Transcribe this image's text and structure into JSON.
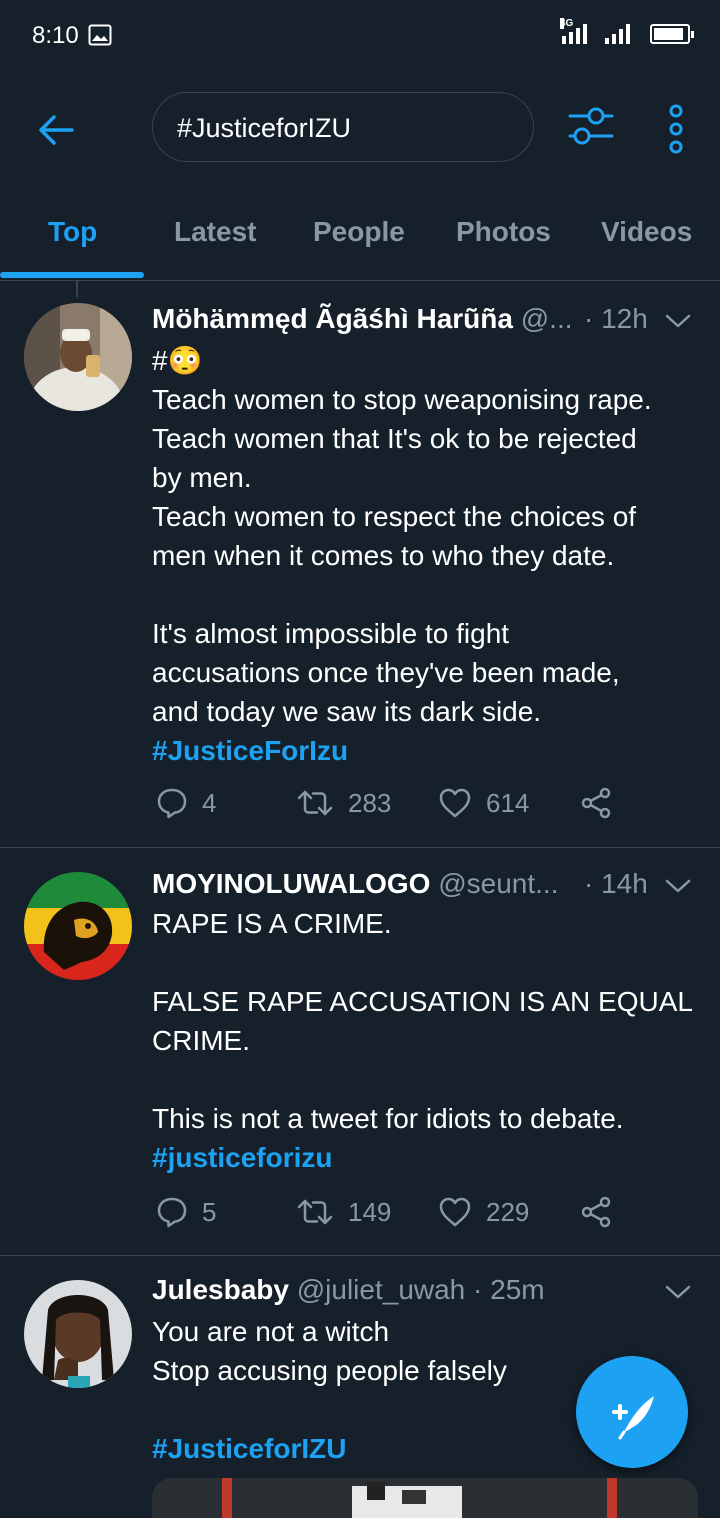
{
  "status_bar": {
    "time": "8:10",
    "network": "4G",
    "battery_level": 0.92
  },
  "search": {
    "query": "#JusticeforIZU"
  },
  "tabs": [
    {
      "label": "Top",
      "active": true
    },
    {
      "label": "Latest",
      "active": false
    },
    {
      "label": "People",
      "active": false
    },
    {
      "label": "Photos",
      "active": false
    },
    {
      "label": "Videos",
      "active": false
    }
  ],
  "tweets": [
    {
      "display_name": "Möhämmęd Ãgãśhì Harũña",
      "handle": "@...",
      "time": "· 12h",
      "lines": [
        "#😳",
        "Teach women to stop weaponising rape.",
        "Teach women that It's ok to be rejected",
        "by men.",
        "Teach women to respect the choices of",
        "men when it comes to who they date.",
        "",
        "It's almost impossible to fight",
        "accusations once they've been made,",
        "and today we saw its dark side."
      ],
      "hashtag": "#JusticeForIzu",
      "replies": "4",
      "retweets": "283",
      "likes": "614"
    },
    {
      "display_name": "MOYINOLUWALOGO",
      "handle": "@seunt...",
      "time": "· 14h",
      "lines": [
        "RAPE IS A CRIME.",
        "",
        "FALSE RAPE ACCUSATION IS AN EQUAL",
        "CRIME.",
        "",
        "This is not a tweet for idiots to debate."
      ],
      "hashtag": "#justiceforizu",
      "replies": "5",
      "retweets": "149",
      "likes": "229"
    },
    {
      "display_name": "Julesbaby",
      "handle": "@juliet_uwah",
      "time": "· 25m",
      "lines": [
        "You are not a witch",
        "Stop accusing people falsely",
        ""
      ],
      "hashtag": "#JusticeforIZU"
    }
  ],
  "colors": {
    "background": "#15202b",
    "accent": "#1da1f2",
    "secondary_text": "#8899a6",
    "divider": "#38444d"
  },
  "icons": {
    "back": "arrow-left-icon",
    "filter": "sliders-icon",
    "more": "more-vertical-icon",
    "reply": "reply-icon",
    "retweet": "retweet-icon",
    "like": "heart-icon",
    "share": "share-icon",
    "compose": "feather-plus-icon"
  }
}
